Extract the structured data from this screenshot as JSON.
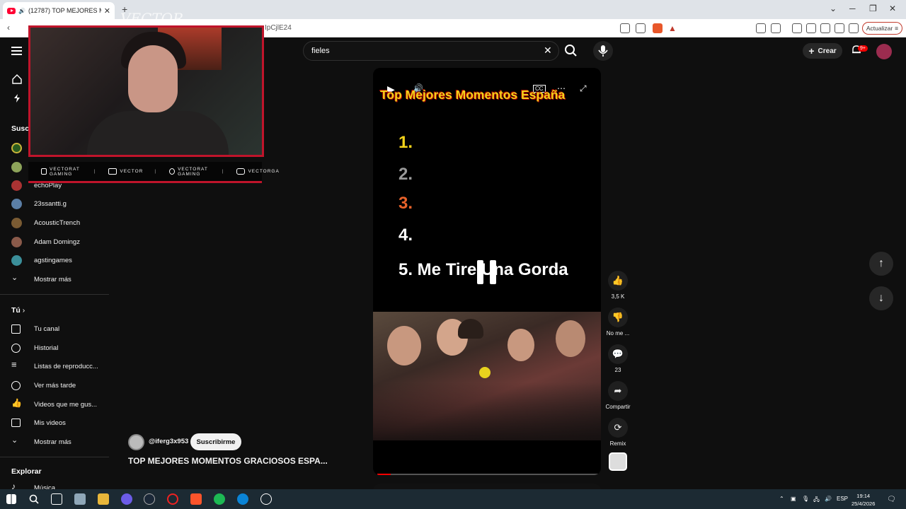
{
  "browser": {
    "tab_title": "(12787) TOP MEJORES MOMENTOS",
    "url_fragment": "IpCjlE24",
    "update_label": "Actualizar"
  },
  "youtube": {
    "search_value": "fieles",
    "create_label": "Crear",
    "notifications_badge": "9+"
  },
  "sidebar": {
    "subs_header": "Susc",
    "subscriptions": [
      {
        "label": "echoPlay",
        "color": "#a33"
      },
      {
        "label": "23ssantti.g",
        "color": "#5b7fa6"
      },
      {
        "label": "AcousticTrench",
        "color": "#7a5b33"
      },
      {
        "label": "Adam Domingz",
        "color": "#8a5a4a"
      },
      {
        "label": "agstingames",
        "color": "#3b8f9a"
      }
    ],
    "show_more": "Mostrar más",
    "you_header": "Tú",
    "you_items": [
      {
        "label": "Tu canal",
        "icon": "user-icon"
      },
      {
        "label": "Historial",
        "icon": "history-icon"
      },
      {
        "label": "Listas de reproducc...",
        "icon": "playlist-icon"
      },
      {
        "label": "Ver más tarde",
        "icon": "clock-icon"
      },
      {
        "label": "Videos que me gus...",
        "icon": "thumbs-up-icon"
      },
      {
        "label": "Mis videos",
        "icon": "video-icon"
      }
    ],
    "show_more_2": "Mostrar más",
    "explore_header": "Explorar",
    "explore_items": [
      {
        "label": "Música",
        "icon": "music-icon"
      }
    ]
  },
  "overlay": {
    "watermark": "VECTOR",
    "socials": [
      "VECTORAT GAMING",
      "VECTOR",
      "VECTORAT GAMING",
      "VECTORGA"
    ]
  },
  "video": {
    "overlay_title": "Top Mejores Momentos España",
    "ranks": [
      "1.",
      "2.",
      "3.",
      "4.",
      "5. Me Tire Una Gorda"
    ],
    "rank_colors": [
      "#f2d21a",
      "#9a9a9a",
      "#e8622a",
      "#ffffff",
      "#ffffff"
    ],
    "progress_fraction": 0.06
  },
  "actions": {
    "like_count": "3,5 K",
    "dislike_label": "No me ...",
    "comments_count": "23",
    "share_label": "Compartir",
    "remix_label": "Remix"
  },
  "channel": {
    "handle": "@iferg3x953",
    "subscribe_label": "Suscribirme",
    "video_title": "TOP MEJORES MOMENTOS GRACIOSOS ESPA..."
  },
  "taskbar": {
    "lang": "ESP",
    "time": "19:14",
    "date": "25/4/2026"
  }
}
